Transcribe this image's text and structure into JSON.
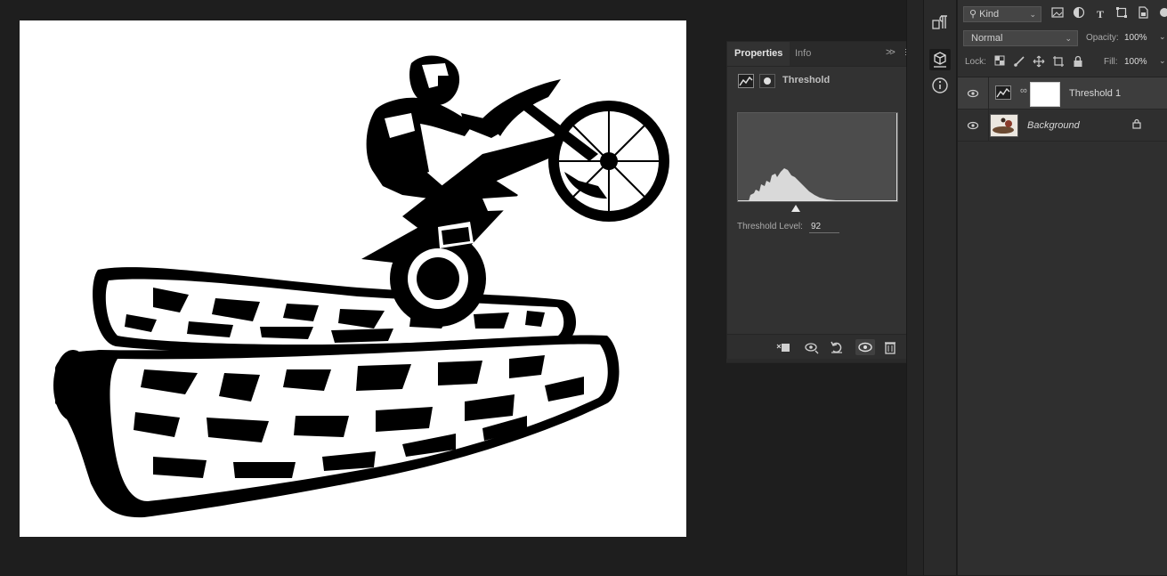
{
  "properties_panel": {
    "tabs": [
      {
        "label": "Properties",
        "active": true
      },
      {
        "label": "Info",
        "active": false
      }
    ],
    "collapse_glyph": ">>",
    "menu_icon": "panel-menu-icon",
    "title": "Threshold",
    "threshold_label": "Threshold Level:",
    "threshold_value": "92",
    "footer_icons": [
      "clip-to-layer-icon",
      "view-previous-state-icon",
      "reset-icon",
      "visibility-icon",
      "trash-icon"
    ]
  },
  "icon_strip": {
    "icons": [
      "paragraph-icon",
      "3d-icon",
      "info-icon"
    ]
  },
  "layers_panel": {
    "filter_kind": "Kind",
    "filter_icons": [
      "image-icon",
      "adjustment-icon",
      "type-icon",
      "shape-icon",
      "smart-object-icon"
    ],
    "blend_mode": "Normal",
    "opacity_label": "Opacity:",
    "opacity_value": "100%",
    "lock_label": "Lock:",
    "lock_icons": [
      "lock-transparent-pixels-icon",
      "lock-image-pixels-icon",
      "lock-position-icon",
      "lock-artboard-icon",
      "lock-all-icon"
    ],
    "fill_label": "Fill:",
    "fill_value": "100%",
    "layers": [
      {
        "name": "Threshold 1",
        "selected": true,
        "visible": true
      },
      {
        "name": "Background",
        "selected": false,
        "visible": true,
        "locked": true
      }
    ]
  },
  "colors": {
    "app_bg": "#1e1e1e",
    "panel_bg": "#323232",
    "selected_layer": "#3d3d3d",
    "document_bg": "#ffffff",
    "histogram_bg": "#4c4c4c",
    "histogram_fill": "#d9d9d9"
  }
}
